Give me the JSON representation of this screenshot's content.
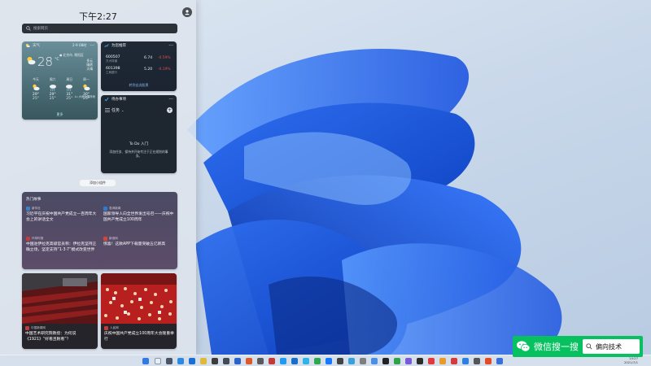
{
  "widgets": {
    "time": "下午2:27",
    "search_placeholder": "搜索网页",
    "add_widget_label": "添加小组件",
    "weather": {
      "title": "天气",
      "date": "2·9 08时",
      "location": "北京市, 朝阳区",
      "temp": "28",
      "unit": "°C",
      "right_lines": [
        "多云",
        "晴转",
        "天晴"
      ],
      "forecast": [
        {
          "day": "今天",
          "icon": "partly-cloudy-icon",
          "hi": "29°",
          "lo": "25°"
        },
        {
          "day": "周六",
          "icon": "rain-icon",
          "hi": "29°",
          "lo": "25°"
        },
        {
          "day": "周日",
          "icon": "rain-icon",
          "hi": "31°",
          "lo": "25°"
        },
        {
          "day": "周一",
          "icon": "partly-cloudy-icon",
          "hi": "30°",
          "lo": "25°"
        }
      ],
      "note": "Lu 大雨及雷阵雨",
      "more": "更多"
    },
    "stocks": {
      "title": "为您推荐",
      "rows": [
        {
          "code": "600507",
          "name": "方大特钢",
          "price": "6.74",
          "change": "-0.59%"
        },
        {
          "code": "601398",
          "name": "工商银行",
          "price": "5.20",
          "change": "-0.19%"
        }
      ],
      "more": "转到自选股票"
    },
    "todo": {
      "title": "待办事项",
      "list_name": "任务",
      "add_icon": "+",
      "empty_title": "To Do 入门",
      "empty_desc": "添加任务、保持并开始专注于正在规划的事务。"
    },
    "top_stories": {
      "heading": "热门故事",
      "stories": [
        {
          "source": "新华社",
          "logo_color": "#3b82c4",
          "title": "习近平在庆祝中国共产党成立一百周年大会上的讲话全文"
        },
        {
          "source": "澎湃新闻",
          "logo_color": "#2e7bd6",
          "title": "国家领导人向全世界发出号召——庆祝中国共产党成立100周年"
        },
        {
          "source": "环球时报",
          "logo_color": "#c43b3b",
          "title": "中国驻伊拉克高级官员称：伊拉克坚持正确立场，坚定支持“1·3·7”模式改变世界"
        },
        {
          "source": "新浪网",
          "logo_color": "#d9443a",
          "title": "惊喜！这款APP下载量突破五亿新高"
        }
      ]
    },
    "image_news": [
      {
        "source": "中国新闻网",
        "logo_color": "#c43b3b",
        "title": "中国艺术研究院教授：为何说《1921》“好看且耐看”？"
      },
      {
        "source": "人民网",
        "logo_color": "#c43b3b",
        "title": "庆祝中国共产党成立100周年大会隆重举行"
      }
    ]
  },
  "taskbar": {
    "tray_time": "14:27",
    "tray_date": "2021/7/1"
  },
  "overlay": {
    "label": "微信搜一搜",
    "query": "偏向技术"
  }
}
